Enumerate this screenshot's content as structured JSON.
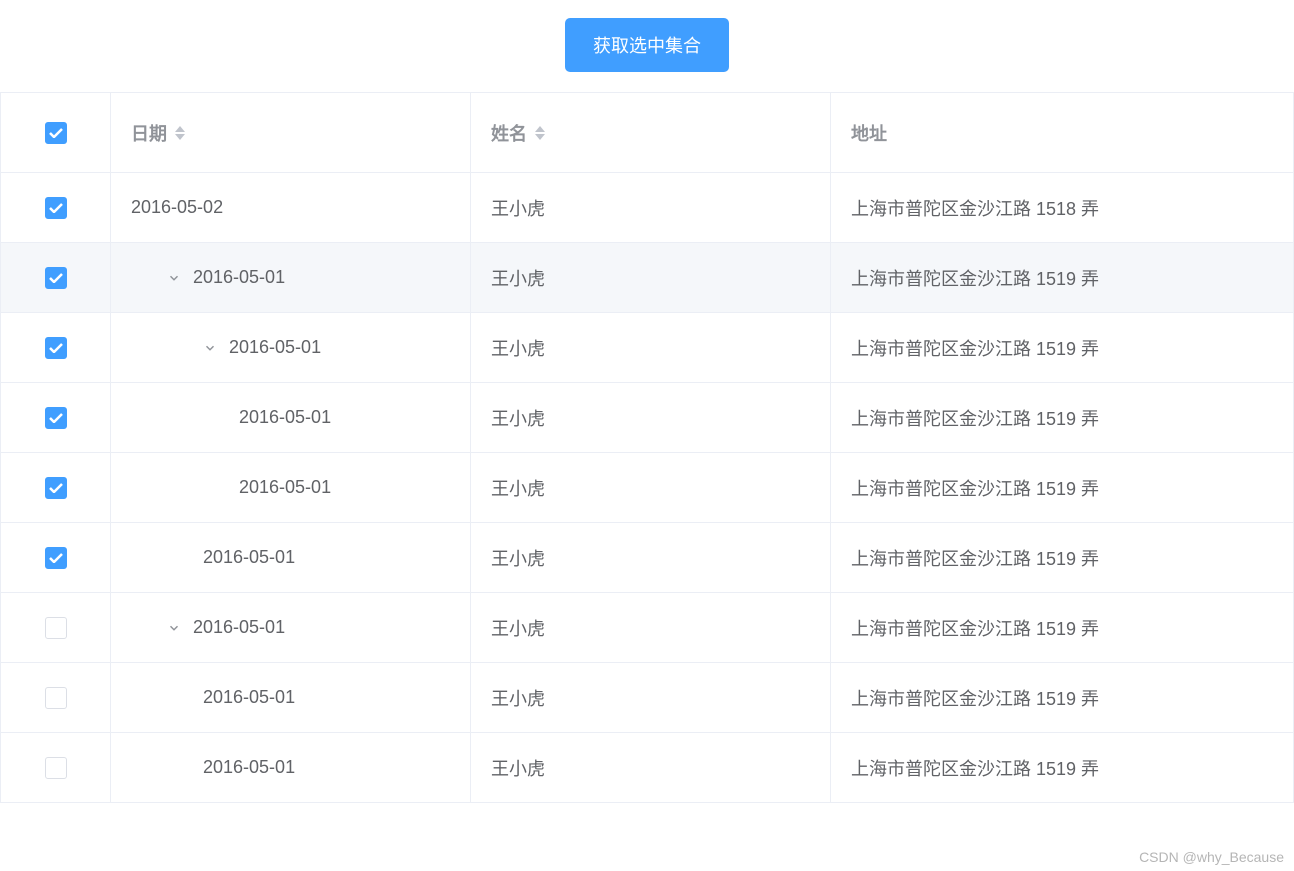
{
  "button": {
    "label": "获取选中集合"
  },
  "columns": {
    "date": "日期",
    "name": "姓名",
    "address": "地址"
  },
  "headerChecked": true,
  "rows": [
    {
      "checked": true,
      "indent": 0,
      "expand": null,
      "date": "2016-05-02",
      "name": "王小虎",
      "address": "上海市普陀区金沙江路 1518 弄",
      "highlight": false
    },
    {
      "checked": true,
      "indent": 1,
      "expand": "open",
      "date": "2016-05-01",
      "name": "王小虎",
      "address": "上海市普陀区金沙江路 1519 弄",
      "highlight": true
    },
    {
      "checked": true,
      "indent": 2,
      "expand": "open",
      "date": "2016-05-01",
      "name": "王小虎",
      "address": "上海市普陀区金沙江路 1519 弄",
      "highlight": false
    },
    {
      "checked": true,
      "indent": 3,
      "expand": null,
      "date": "2016-05-01",
      "name": "王小虎",
      "address": "上海市普陀区金沙江路 1519 弄",
      "highlight": false
    },
    {
      "checked": true,
      "indent": 3,
      "expand": null,
      "date": "2016-05-01",
      "name": "王小虎",
      "address": "上海市普陀区金沙江路 1519 弄",
      "highlight": false
    },
    {
      "checked": true,
      "indent": 2,
      "expand": null,
      "date": "2016-05-01",
      "name": "王小虎",
      "address": "上海市普陀区金沙江路 1519 弄",
      "highlight": false
    },
    {
      "checked": false,
      "indent": 1,
      "expand": "open",
      "date": "2016-05-01",
      "name": "王小虎",
      "address": "上海市普陀区金沙江路 1519 弄",
      "highlight": false
    },
    {
      "checked": false,
      "indent": 2,
      "expand": null,
      "date": "2016-05-01",
      "name": "王小虎",
      "address": "上海市普陀区金沙江路 1519 弄",
      "highlight": false
    },
    {
      "checked": false,
      "indent": 2,
      "expand": null,
      "date": "2016-05-01",
      "name": "王小虎",
      "address": "上海市普陀区金沙江路 1519 弄",
      "highlight": false
    }
  ],
  "watermark": "CSDN @why_Because"
}
